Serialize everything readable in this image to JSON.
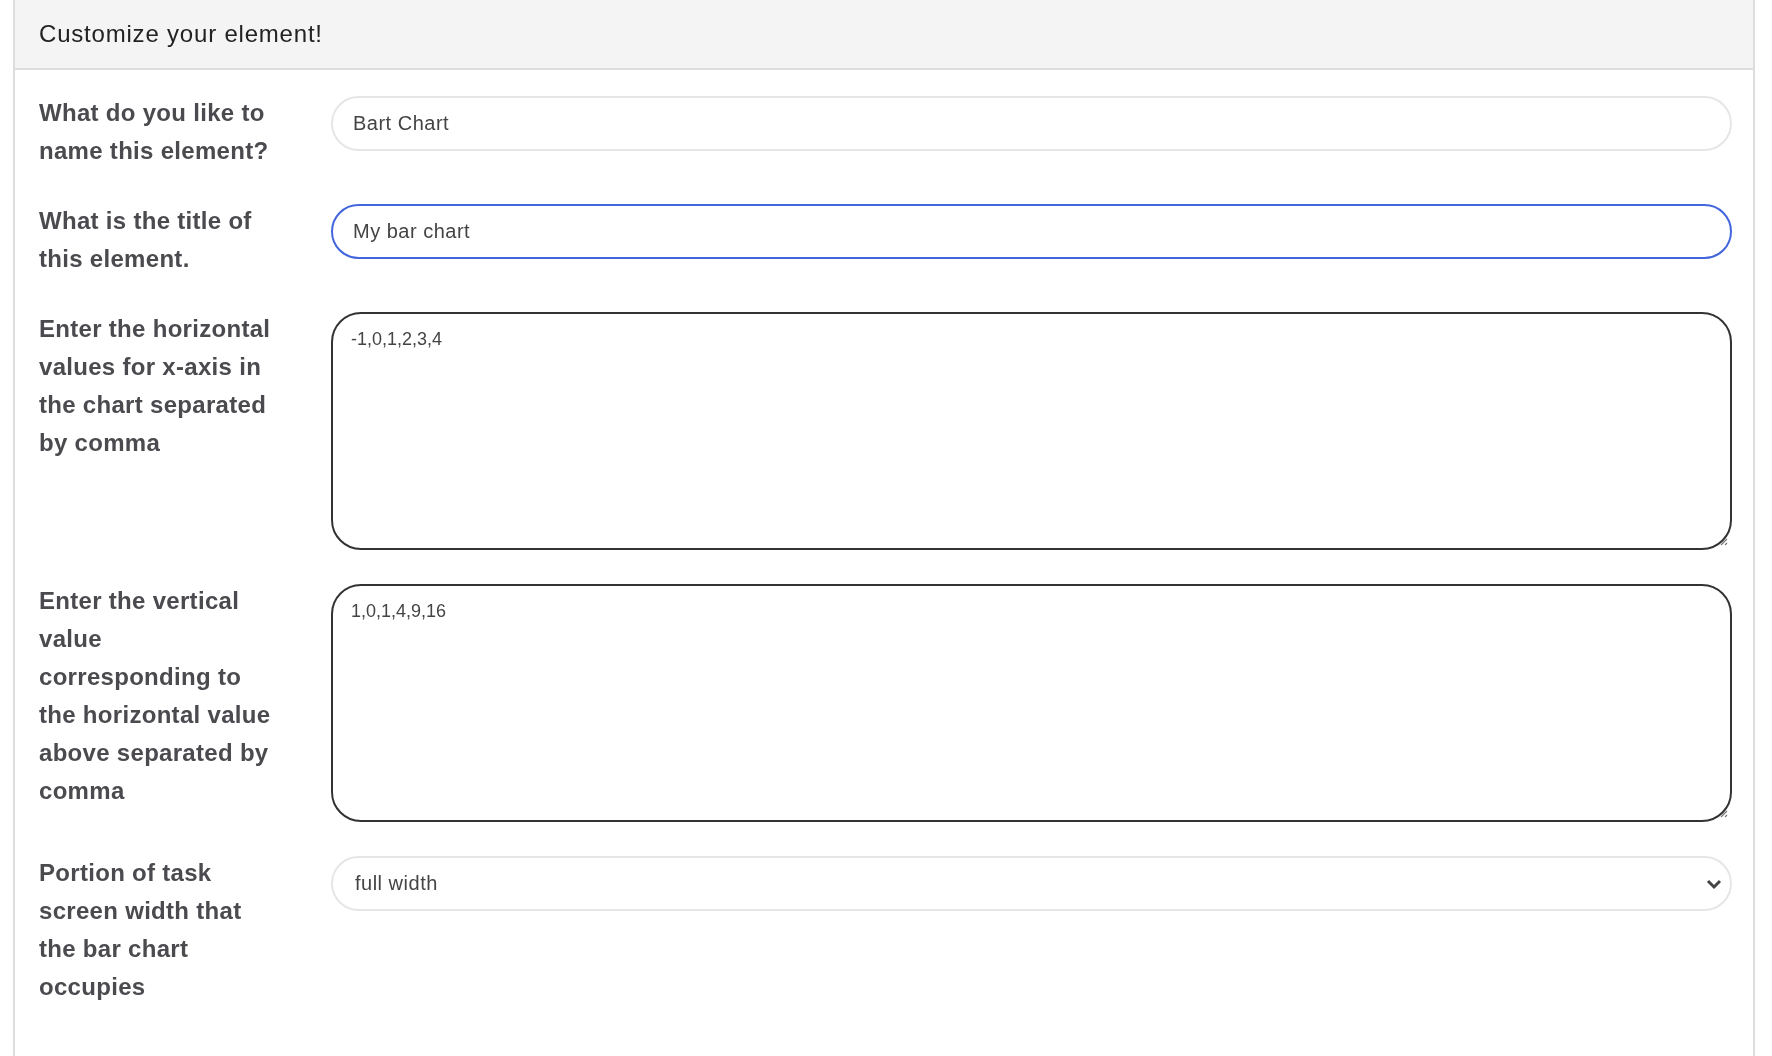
{
  "panel": {
    "title": "Customize your element!"
  },
  "fields": [
    {
      "kind": "text",
      "label": "What do you like to name this element?",
      "value": "Bart Chart",
      "focused": false
    },
    {
      "kind": "text",
      "label": "What is the title of this element.",
      "value": "My bar chart",
      "focused": true
    },
    {
      "kind": "textarea",
      "label": "Enter the horizontal values for x-axis in the chart separated by comma",
      "value": "-1,0,1,2,3,4",
      "focused": false
    },
    {
      "kind": "textarea",
      "label": "Enter the vertical value corresponding to the horizontal value above separated by comma",
      "value": "1,0,1,4,9,16",
      "focused": false
    },
    {
      "kind": "select",
      "label": "Portion of task screen width that the bar chart occupies",
      "value": "full width",
      "focused": false
    }
  ]
}
